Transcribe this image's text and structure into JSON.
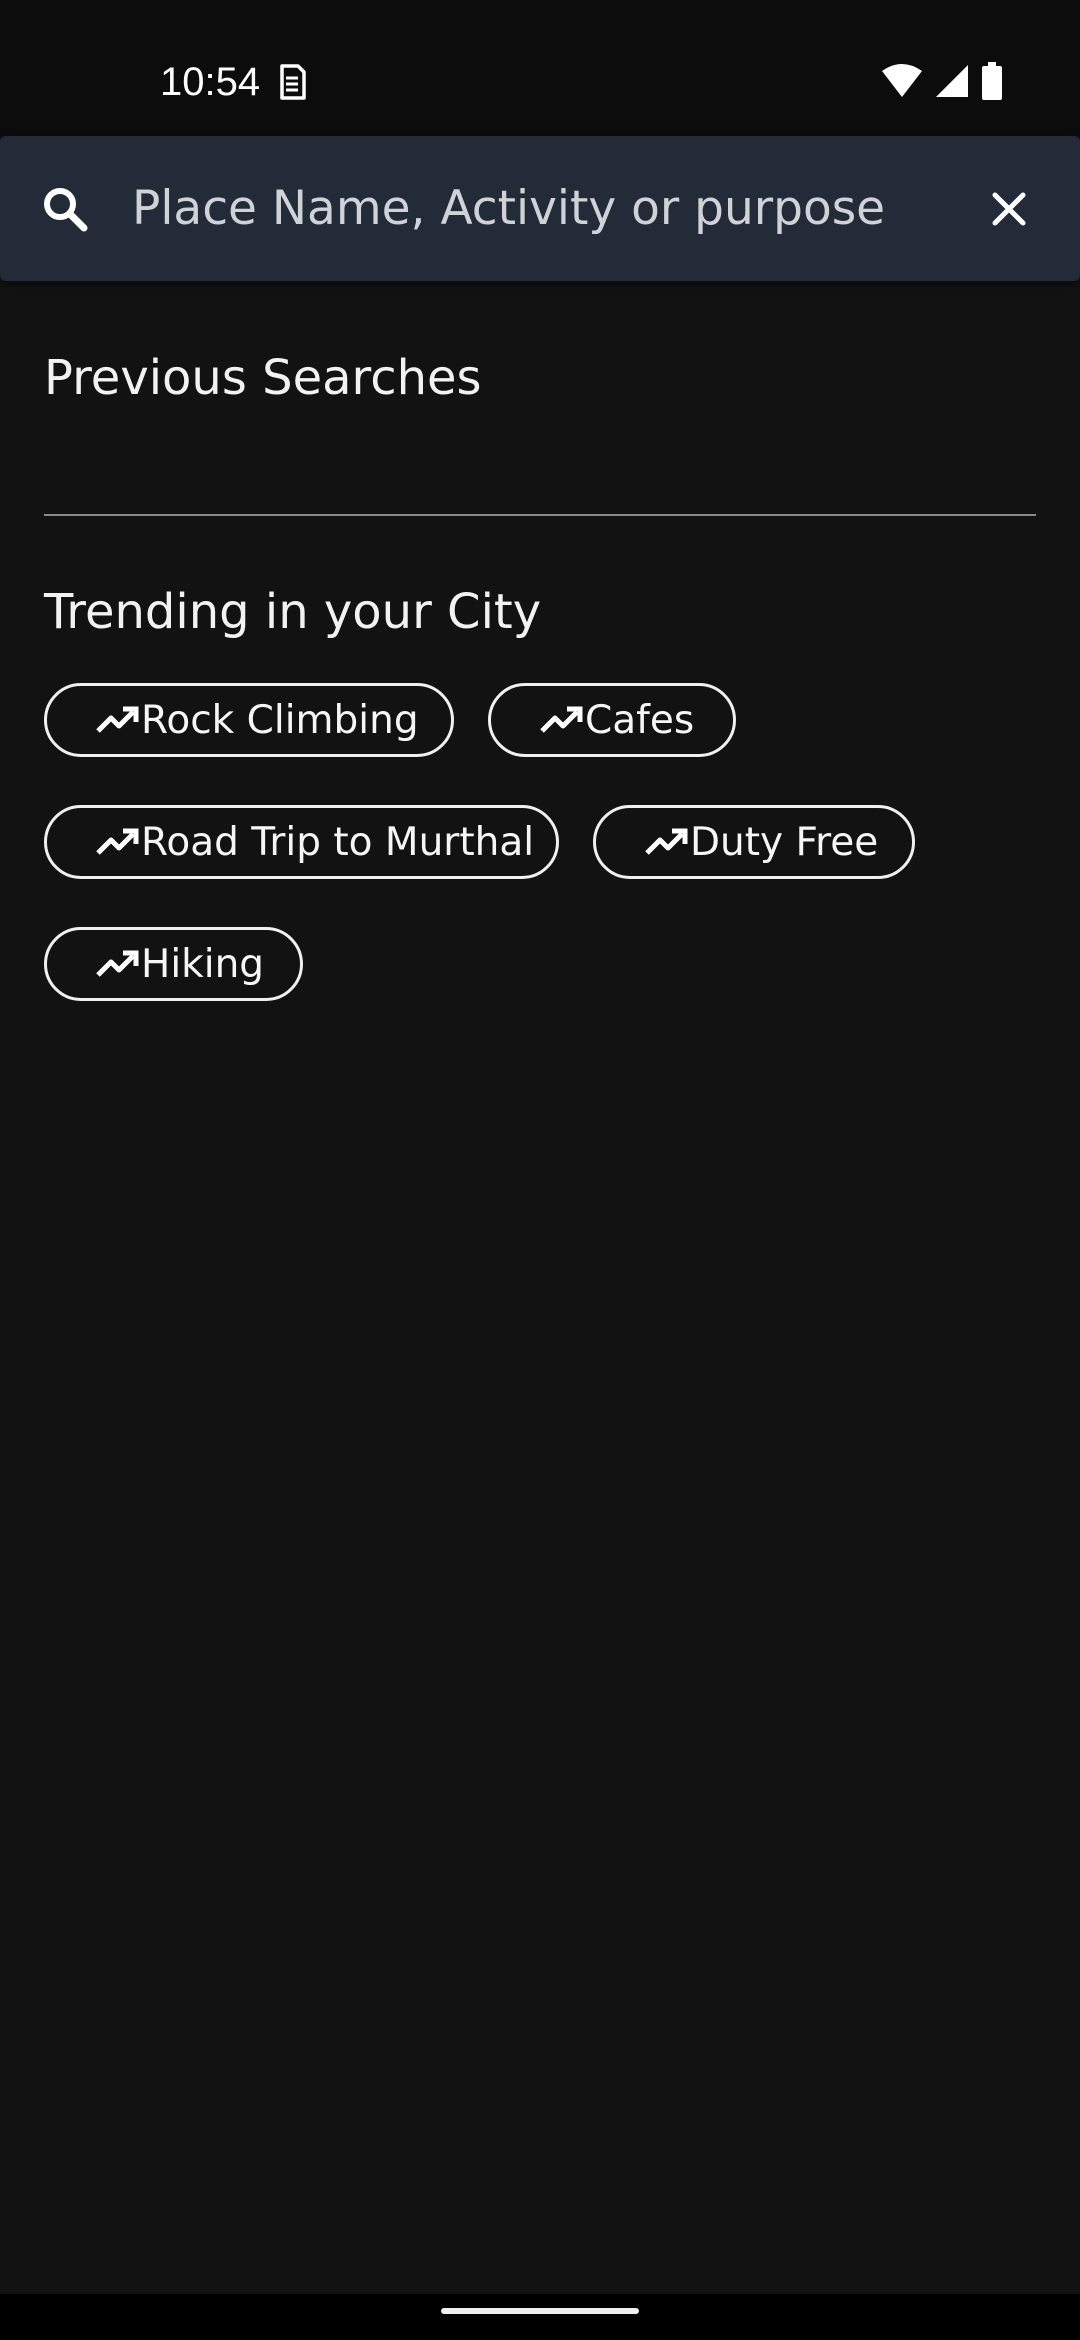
{
  "status_bar": {
    "time": "10:54",
    "icons": [
      "sim-card-icon",
      "wifi-icon",
      "signal-icon",
      "battery-icon"
    ]
  },
  "search": {
    "placeholder": "Place Name, Activity or purpose",
    "value": "",
    "search_icon": "search-icon",
    "close_icon": "close-icon"
  },
  "previous_searches": {
    "title": "Previous Searches",
    "items": []
  },
  "trending": {
    "title": "Trending in your City",
    "chip_icon": "trending-up-icon",
    "chips": [
      {
        "label": "Rock Climbing"
      },
      {
        "label": "Cafes"
      },
      {
        "label": "Road Trip to Murthal"
      },
      {
        "label": "Duty Free"
      },
      {
        "label": "Hiking"
      }
    ]
  },
  "colors": {
    "background": "#121212",
    "search_bar": "#232b38",
    "chip_border": "#f0f0f0",
    "divider": "#8a8a8a"
  }
}
